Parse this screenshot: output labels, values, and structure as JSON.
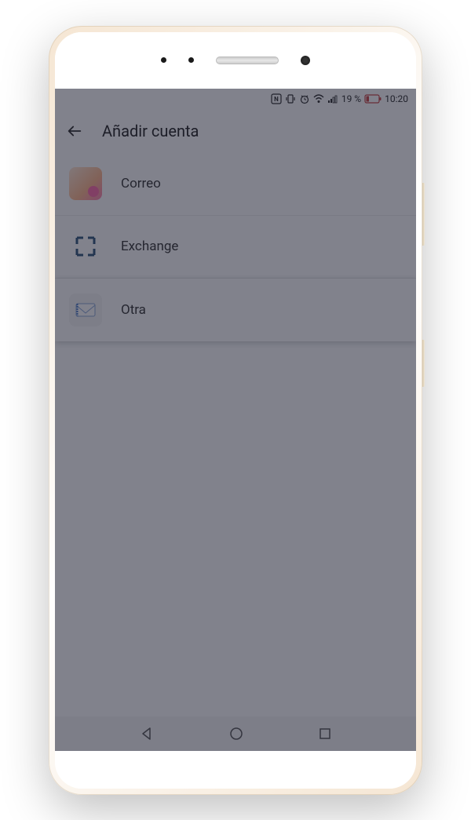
{
  "statusBar": {
    "battery": "19 %",
    "time": "10:20"
  },
  "header": {
    "title": "Añadir cuenta"
  },
  "accounts": {
    "items": [
      {
        "label": "Correo",
        "icon": "correo-icon",
        "highlighted": false
      },
      {
        "label": "Exchange",
        "icon": "exchange-icon",
        "highlighted": false
      },
      {
        "label": "Otra",
        "icon": "mail-icon",
        "highlighted": true
      }
    ]
  }
}
